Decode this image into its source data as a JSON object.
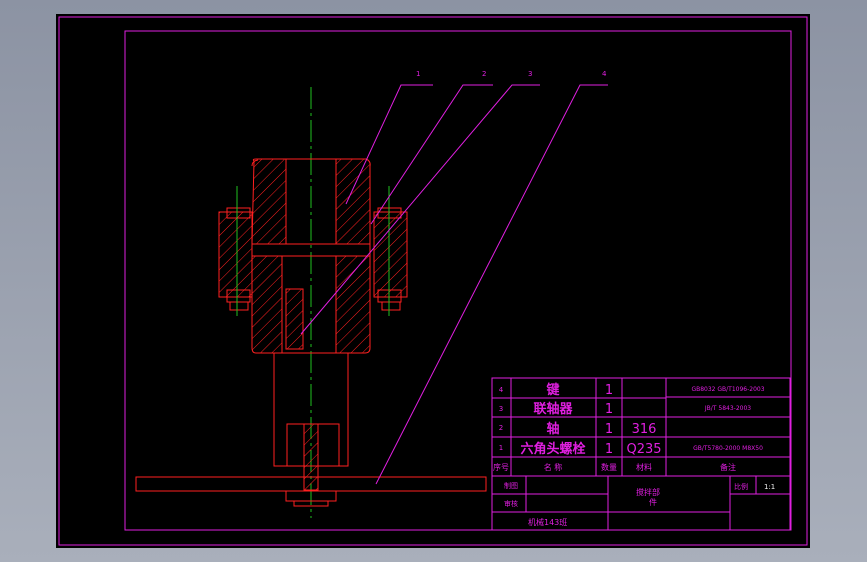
{
  "colors": {
    "background": "#000000",
    "border": "#e01fe0",
    "geometry": "#ff2020",
    "centerline": "#20c020"
  },
  "balloons": [
    "1",
    "2",
    "3",
    "4"
  ],
  "parts": [
    {
      "no": "4",
      "name": "键",
      "qty": "1",
      "material": "",
      "standard": "GB8032 GB/T1096-2003"
    },
    {
      "no": "3",
      "name": "联轴器",
      "qty": "1",
      "material": "",
      "standard": "JB/T 5843-2003"
    },
    {
      "no": "2",
      "name": "轴",
      "qty": "1",
      "material": "316",
      "standard": ""
    },
    {
      "no": "1",
      "name": "六角头螺栓",
      "qty": "1",
      "material": "Q235",
      "standard": "GB/T5780-2000 M8X50"
    }
  ],
  "header": {
    "no": "序号",
    "name": "名 称",
    "qty": "数量",
    "material": "材料",
    "remark": "备注"
  },
  "title_block": {
    "drawn_label": "制图",
    "check_label": "审核",
    "title_line1": "搅拌部",
    "title_line2": "件",
    "scale_label": "比例",
    "scale_value": "1:1",
    "company": "机械143班"
  }
}
